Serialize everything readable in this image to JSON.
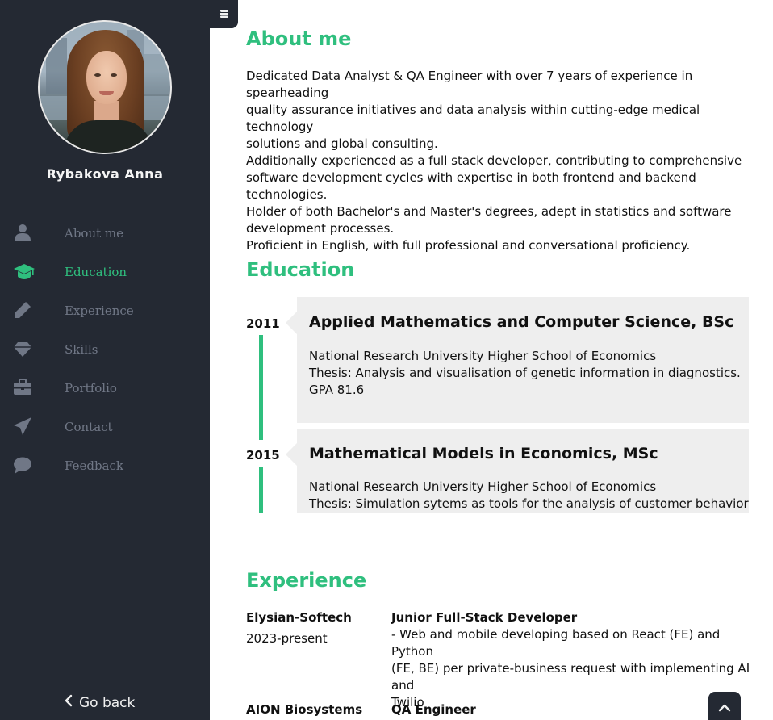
{
  "profile": {
    "name": "Rybakova Anna"
  },
  "nav": {
    "items": [
      {
        "label": "About me",
        "icon": "user-icon",
        "active": false
      },
      {
        "label": "Education",
        "icon": "graduation-cap-icon",
        "active": true
      },
      {
        "label": "Experience",
        "icon": "pencil-icon",
        "active": false
      },
      {
        "label": "Skills",
        "icon": "diamond-icon",
        "active": false
      },
      {
        "label": "Portfolio",
        "icon": "briefcase-icon",
        "active": false
      },
      {
        "label": "Contact",
        "icon": "paper-plane-icon",
        "active": false
      },
      {
        "label": "Feedback",
        "icon": "comment-icon",
        "active": false
      }
    ],
    "go_back": "Go back"
  },
  "about": {
    "heading": "About me",
    "lines": [
      "Dedicated Data Analyst & QA Engineer with over 7 years of experience in spearheading",
      "quality assurance initiatives and data analysis within cutting-edge medical technology",
      "solutions and global consulting.",
      "Additionally experienced as a full stack developer, contributing to comprehensive",
      "software development cycles with expertise in both frontend and backend technologies.",
      "Holder of both Bachelor's and Master's degrees, adept in statistics and software",
      "development processes.",
      "Proficient in English, with full professional and conversational proficiency."
    ]
  },
  "education": {
    "heading": "Education",
    "entries": [
      {
        "year": "2011",
        "title": "Applied Mathematics and Computer Science, BSc",
        "lines": [
          "National Research University Higher School of Economics",
          "Thesis: Analysis and visualisation of genetic information in diagnostics.",
          "GPA 81.6"
        ]
      },
      {
        "year": "2015",
        "title": "Mathematical Models in Economics, MSc",
        "lines": [
          "National Research University Higher School of Economics",
          "Thesis: Simulation sytems as tools for the analysis of customer behavior"
        ]
      }
    ]
  },
  "experience": {
    "heading": "Experience",
    "entries": [
      {
        "company": "Elysian-Softech",
        "period": "2023-present",
        "role": "Junior Full-Stack Developer",
        "desc_lines": [
          "- Web and mobile developing based on React (FE) and Python",
          "(FE, BE) per private-business request with implementing AI and",
          "Twilio"
        ]
      },
      {
        "company": "AION Biosystems",
        "period": "",
        "role": "QA Engineer",
        "desc_lines": []
      }
    ]
  },
  "colors": {
    "accent": "#2fbf7e",
    "sidebar": "#242933",
    "card": "#eeeeee"
  }
}
